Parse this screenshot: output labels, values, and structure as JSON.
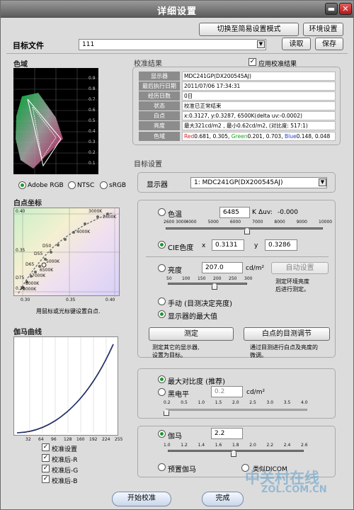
{
  "window": {
    "title": "详细设置"
  },
  "top": {
    "simple_mode_button": "切换至简易设置模式",
    "env_button": "环境设置",
    "target_file_label": "目标文件",
    "target_file_value": "111",
    "read_button": "读取",
    "save_button": "保存"
  },
  "gamut": {
    "label": "色域",
    "grid_labels": [
      "0.9",
      "0.8",
      "0.7",
      "0.6",
      "0.5",
      "0.4",
      "0.3",
      "0.2",
      "0.1"
    ],
    "options": [
      "Adobe RGB",
      "NTSC",
      "sRGB"
    ],
    "selected": "Adobe RGB"
  },
  "whitepoint": {
    "label": "白点坐标",
    "y_labels": [
      "0.40",
      "0.35",
      "0.30"
    ],
    "x_labels": [
      "0.30",
      "0.35",
      "0.40"
    ],
    "k_labels": [
      "3000K",
      "2600K",
      "4000K",
      "D50",
      "D55",
      "5000K",
      "D65",
      "6500K",
      "7000K",
      "D75",
      "8000K",
      "9000K"
    ],
    "hint": "用鼠标或光标键设置白点."
  },
  "gamma": {
    "label": "伽马曲线",
    "x_labels": [
      "32",
      "64",
      "96",
      "128",
      "160",
      "192",
      "224",
      "255"
    ],
    "checkboxes": [
      "校准设置",
      "校准后-R",
      "校准后-G",
      "校准后-B"
    ]
  },
  "results": {
    "label": "校准结果",
    "apply_label": "应用校准结果",
    "rows": [
      {
        "k": "显示器",
        "v": "MDC241GP(DX200545AJ)"
      },
      {
        "k": "最后执行日期",
        "v": "2011/07/06 17:34:31"
      },
      {
        "k": "经历日数",
        "v": "0日"
      },
      {
        "k": "状态",
        "v": "校准已正常结束"
      },
      {
        "k": "白点",
        "v": "x:0.3127, y:0.3287, 6500K(delta uv:-0.0002)"
      },
      {
        "k": "亮度",
        "v": "最大321cd/m2 , 最小0.62cd/m2, (对比度: 517:1)"
      }
    ],
    "gamut_row_key": "色域",
    "gamut_red": "Red",
    "gamut_red_val": "0.681, 0.305",
    "gamut_green": "Green",
    "gamut_green_val": "0.201, 0.703",
    "gamut_blue": "Blue",
    "gamut_blue_val": "0.148, 0.048"
  },
  "target": {
    "label": "目标设置",
    "monitor_label": "显示器",
    "monitor_value": "1: MDC241GP(DX200545AJ)",
    "color_temp_label": "色温",
    "color_temp_value": "6485",
    "color_temp_unit": "K",
    "delta_uv_label": "Δuv:",
    "delta_uv_value": "-0.000",
    "temp_ticks": [
      "2600 3000",
      "4000",
      "5000",
      "6000",
      "7000",
      "8000",
      "9000",
      "10000"
    ],
    "cie_label": "CIE色度",
    "x_label": "x",
    "x_value": "0.3131",
    "y_label": "y",
    "y_value": "0.3286",
    "brightness_label": "亮度",
    "brightness_value": "207.0",
    "brightness_unit": "cd/m²",
    "auto_button": "自动设置",
    "brightness_ticks": [
      "50",
      "100",
      "150",
      "200",
      "250",
      "300"
    ],
    "ambient_note_1": "测定环境亮度",
    "ambient_note_2": "后进行测定。",
    "manual_label": "手动 (目测决定亮度)",
    "max_label": "显示器的最大值",
    "measure_button": "测定",
    "measure_note_1": "测定其它的显示器,",
    "measure_note_2": "设置为目标。",
    "visual_button": "白点的目测调节",
    "visual_note_1": "通过目测进行白点及亮度的",
    "visual_note_2": "微调。",
    "max_contrast_label": "最大对比度 (推荐)",
    "black_label": "黑电平",
    "black_value": "0.2",
    "black_unit": "cd/m²",
    "black_ticks": [
      "0.2",
      "0.5",
      "1.0",
      "1.5",
      "2.0",
      "2.5",
      "3.0",
      "3.5",
      "4.0"
    ],
    "gamma_label": "伽马",
    "gamma_value": "2.2",
    "gamma_ticks": [
      "1.0",
      "1.2",
      "1.4",
      "1.6",
      "1.8",
      "2.0",
      "2.2",
      "2.4",
      "2.6"
    ],
    "preset_gamma_label": "预置伽马",
    "dicom_label": "类似DICOM"
  },
  "bottom": {
    "start_button": "开始校准",
    "done_button": "完成"
  },
  "watermark": {
    "text": "中关村在线",
    "sub": "ZOL.COM.CN"
  },
  "colors": {
    "accent_green": "#1a9a2a",
    "title_bar": "#6e6e6e"
  }
}
